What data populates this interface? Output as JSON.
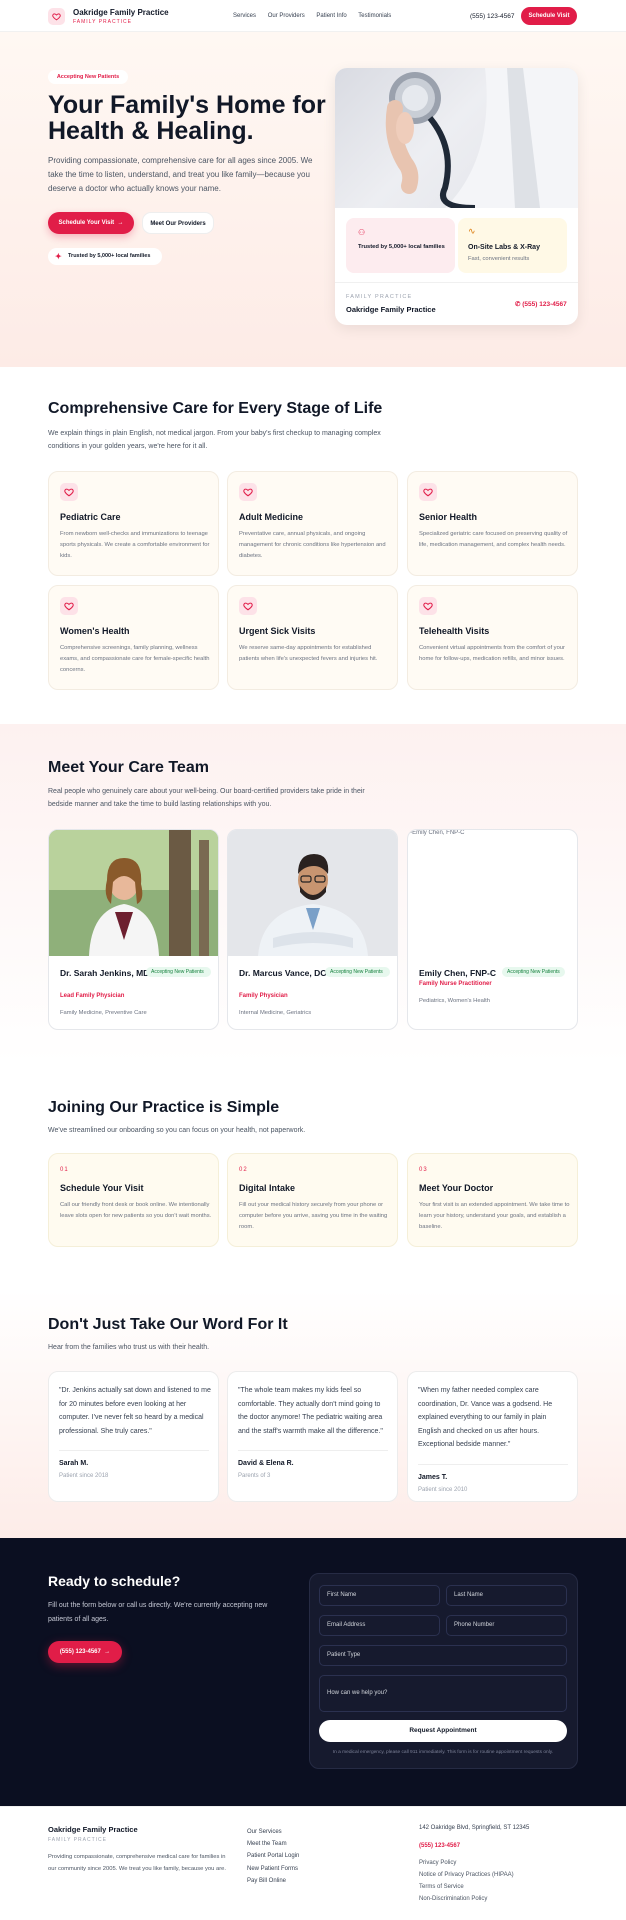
{
  "nav": {
    "brand": "Oakridge Family Practice",
    "tagline": "FAMILY PRACTICE",
    "links": [
      "Services",
      "Our Providers",
      "Patient Info",
      "Testimonials"
    ],
    "phone": "(555) 123-4567",
    "cta": "Schedule Visit"
  },
  "hero": {
    "badge": "Accepting New Patients",
    "title": "Your Family's Home for Health & Healing.",
    "description": "Providing compassionate, comprehensive care for all ages since 2005. We take the time to listen, understand, and treat you like family—because you deserve a doctor who actually knows your name.",
    "primary_cta": "Schedule Your Visit",
    "secondary_cta": "Meet Our Providers",
    "trust": "Trusted by 5,000+ local families",
    "card": {
      "stat1": "Trusted by 5,000+ local families",
      "stat2_title": "On-Site Labs & X-Ray",
      "stat2_sub": "Fast, convenient results",
      "label": "FAMILY PRACTICE",
      "name": "Oakridge Family Practice",
      "phone": "(555) 123-4567"
    }
  },
  "services": {
    "title": "Comprehensive Care for Every Stage of Life",
    "description": "We explain things in plain English, not medical jargon. From your baby's first checkup to managing complex conditions in your golden years, we're here for it all.",
    "items": [
      {
        "title": "Pediatric Care",
        "text": "From newborn well-checks and immunizations to teenage sports physicals. We create a comfortable environment for kids."
      },
      {
        "title": "Adult Medicine",
        "text": "Preventative care, annual physicals, and ongoing management for chronic conditions like hypertension and diabetes."
      },
      {
        "title": "Senior Health",
        "text": "Specialized geriatric care focused on preserving quality of life, medication management, and complex health needs."
      },
      {
        "title": "Women's Health",
        "text": "Comprehensive screenings, family planning, wellness exams, and compassionate care for female-specific health concerns."
      },
      {
        "title": "Urgent Sick Visits",
        "text": "We reserve same-day appointments for established patients when life's unexpected fevers and injuries hit."
      },
      {
        "title": "Telehealth Visits",
        "text": "Convenient virtual appointments from the comfort of your home for follow-ups, medication refills, and minor issues."
      }
    ]
  },
  "team": {
    "title": "Meet Your Care Team",
    "description": "Real people who genuinely care about your well-being. Our board-certified providers take pride in their bedside manner and take the time to build lasting relationships with you.",
    "doctors": [
      {
        "name": "Dr. Sarah Jenkins, MD",
        "badge": "Accepting New Patients",
        "role": "Lead Family Physician",
        "specialty": "Family Medicine, Preventive Care"
      },
      {
        "name": "Dr. Marcus Vance, DO",
        "badge": "Accepting New Patients",
        "role": "Family Physician",
        "specialty": "Internal Medicine, Geriatrics"
      },
      {
        "name": "Emily Chen, FNP-C",
        "badge": "Accepting New Patients",
        "role": "Family Nurse Practitioner",
        "specialty": "Pediatrics, Women's Health",
        "img_alt": "Emily Chen, FNP-C"
      }
    ]
  },
  "onboarding": {
    "title": "Joining Our Practice is Simple",
    "description": "We've streamlined our onboarding so you can focus on your health, not paperwork.",
    "steps": [
      {
        "num": "01",
        "title": "Schedule Your Visit",
        "text": "Call our friendly front desk or book online. We intentionally leave slots open for new patients so you don't wait months."
      },
      {
        "num": "02",
        "title": "Digital Intake",
        "text": "Fill out your medical history securely from your phone or computer before you arrive, saving you time in the waiting room."
      },
      {
        "num": "03",
        "title": "Meet Your Doctor",
        "text": "Your first visit is an extended appointment. We take time to learn your history, understand your goals, and establish a baseline."
      }
    ]
  },
  "testimonials": {
    "title": "Don't Just Take Our Word For It",
    "description": "Hear from the families who trust us with their health.",
    "items": [
      {
        "quote": "\"Dr. Jenkins actually sat down and listened to me for 20 minutes before even looking at her computer. I've never felt so heard by a medical professional. She truly cares.\"",
        "author": "Sarah M.",
        "since": "Patient since 2018"
      },
      {
        "quote": "\"The whole team makes my kids feel so comfortable. They actually don't mind going to the doctor anymore! The pediatric waiting area and the staff's warmth make all the difference.\"",
        "author": "David & Elena R.",
        "since": "Parents of 3"
      },
      {
        "quote": "\"When my father needed complex care coordination, Dr. Vance was a godsend. He explained everything to our family in plain English and checked on us after hours. Exceptional bedside manner.\"",
        "author": "James T.",
        "since": "Patient since 2010"
      }
    ]
  },
  "cta": {
    "title": "Ready to schedule?",
    "description": "Fill out the form below or call us directly. We're currently accepting new patients of all ages.",
    "phone_button": "(555) 123-4567",
    "form": {
      "first_name": "First Name",
      "last_name": "Last Name",
      "email": "Email Address",
      "phone": "Phone Number",
      "patient_type": "Patient Type",
      "message": "How can we help you?",
      "submit": "Request Appointment",
      "disclaimer": "In a medical emergency, please call 911 immediately. This form is for routine appointment requests only."
    }
  },
  "footer": {
    "brand": "Oakridge Family Practice",
    "tagline": "FAMILY PRACTICE",
    "about": "Providing compassionate, comprehensive medical care for families in our community since 2005. We treat you like family, because you are.",
    "links": [
      "Our Services",
      "Meet the Team",
      "Patient Portal Login",
      "New Patient Forms",
      "Pay Bill Online"
    ],
    "address": "142 Oakridge Blvd, Springfield, ST 12345",
    "phone": "(555) 123-4567",
    "legal": [
      "Privacy Policy",
      "Notice of Privacy Practices (HIPAA)",
      "Terms of Service",
      "Non-Discrimination Policy"
    ]
  },
  "colors": {
    "accent": "#e11d48",
    "dark": "#0b0f21",
    "success": "#15803d"
  }
}
